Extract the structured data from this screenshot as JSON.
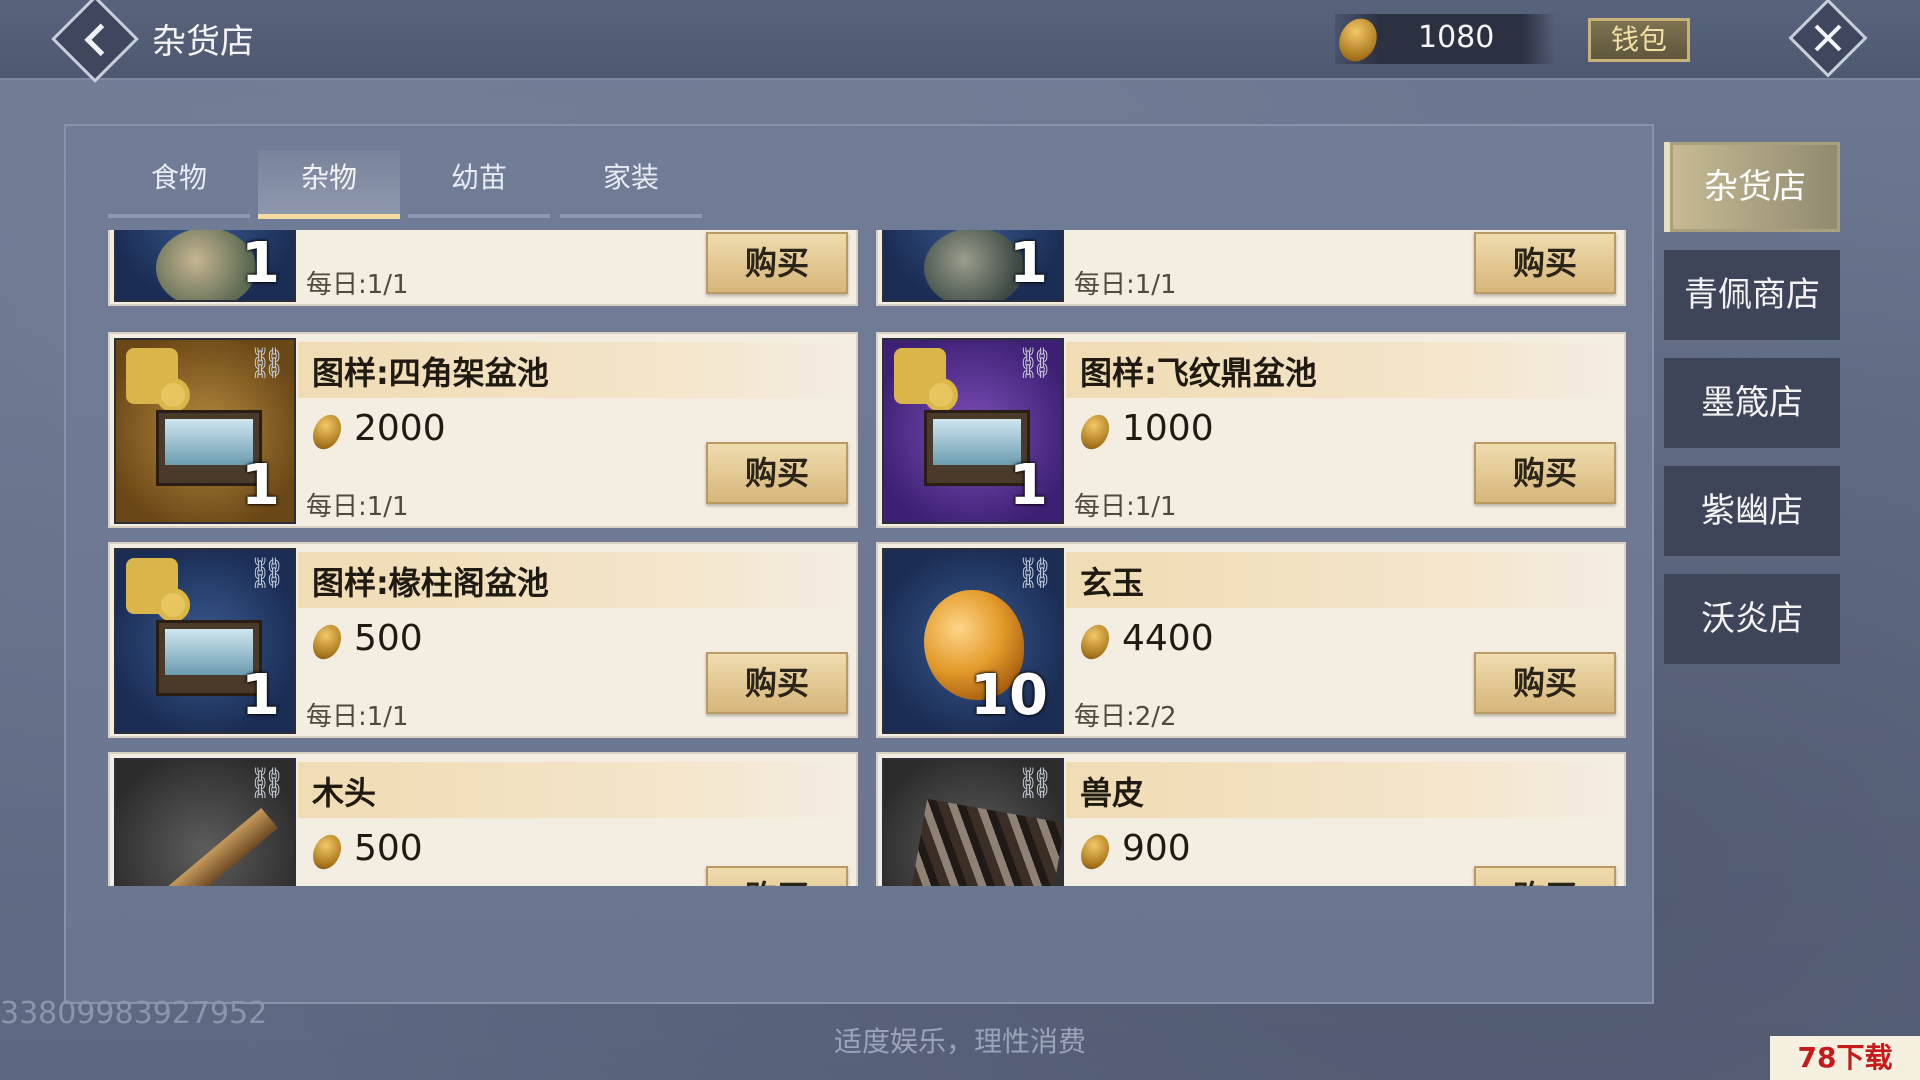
{
  "header": {
    "title": "杂货店",
    "currency_value": "1080",
    "wallet_label": "钱包"
  },
  "tabs": [
    {
      "label": "食物"
    },
    {
      "label": "杂物"
    },
    {
      "label": "幼苗"
    },
    {
      "label": "家装"
    }
  ],
  "active_tab": "杂物",
  "items": [
    {
      "name": "",
      "price": "",
      "limit": "每日:1/1",
      "count": "1",
      "buy_label": "购买"
    },
    {
      "name": "",
      "price": "",
      "limit": "每日:1/1",
      "count": "1",
      "buy_label": "购买"
    },
    {
      "name": "图样:四角架盆池",
      "price": "2000",
      "limit": "每日:1/1",
      "count": "1",
      "buy_label": "购买"
    },
    {
      "name": "图样:飞纹鼎盆池",
      "price": "1000",
      "limit": "每日:1/1",
      "count": "1",
      "buy_label": "购买"
    },
    {
      "name": "图样:椽柱阁盆池",
      "price": "500",
      "limit": "每日:1/1",
      "count": "1",
      "buy_label": "购买"
    },
    {
      "name": "玄玉",
      "price": "4400",
      "limit": "每日:2/2",
      "count": "10",
      "buy_label": "购买"
    },
    {
      "name": "木头",
      "price": "500",
      "limit": "",
      "count": "",
      "buy_label": "购买"
    },
    {
      "name": "兽皮",
      "price": "900",
      "limit": "",
      "count": "",
      "buy_label": "购买"
    }
  ],
  "sidebar": {
    "items": [
      {
        "label": "杂货店"
      },
      {
        "label": "青佩商店"
      },
      {
        "label": "墨箴店"
      },
      {
        "label": "紫幽店"
      },
      {
        "label": "沃炎店"
      }
    ]
  },
  "footer": {
    "note": "适度娱乐，理性消费",
    "uid": "33809983927952",
    "watermark": "78下载"
  },
  "icons": {
    "back": "back-arrow-icon",
    "close": "close-icon",
    "currency": "coin-icon",
    "link": "link-chain-icon"
  }
}
